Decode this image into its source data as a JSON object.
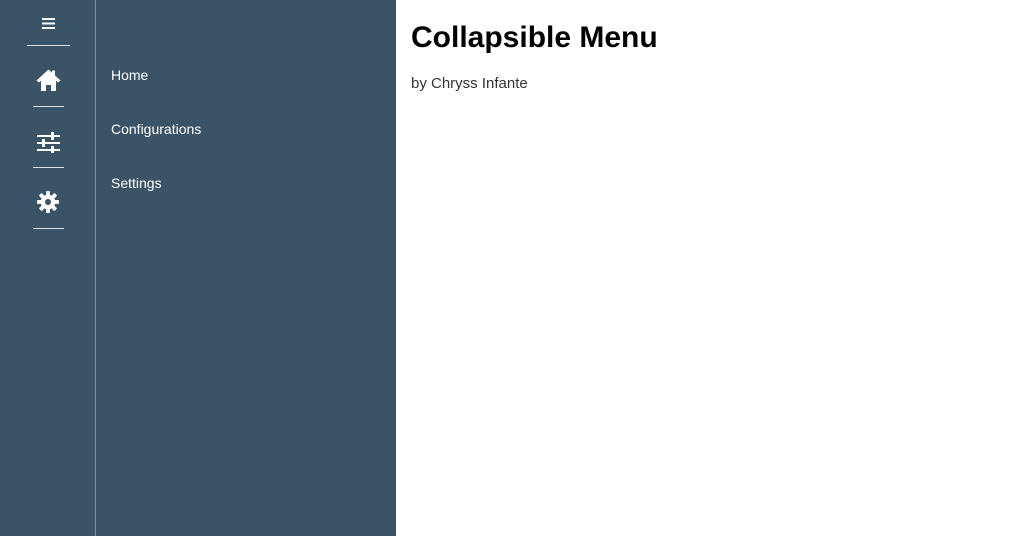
{
  "colors": {
    "sidebar": "#3b5366",
    "sidebar_text": "#ffffff",
    "content_background": "#ffffff",
    "title": "#000000",
    "byline": "#333333"
  },
  "sidebar": {
    "icons": [
      "menu-icon",
      "home-icon",
      "sliders-icon",
      "gear-icon"
    ],
    "items": [
      {
        "label": "Home",
        "icon": "home-icon"
      },
      {
        "label": "Configurations",
        "icon": "sliders-icon"
      },
      {
        "label": "Settings",
        "icon": "gear-icon"
      }
    ]
  },
  "main": {
    "title": "Collapsible Menu",
    "byline": "by Chryss Infante"
  }
}
